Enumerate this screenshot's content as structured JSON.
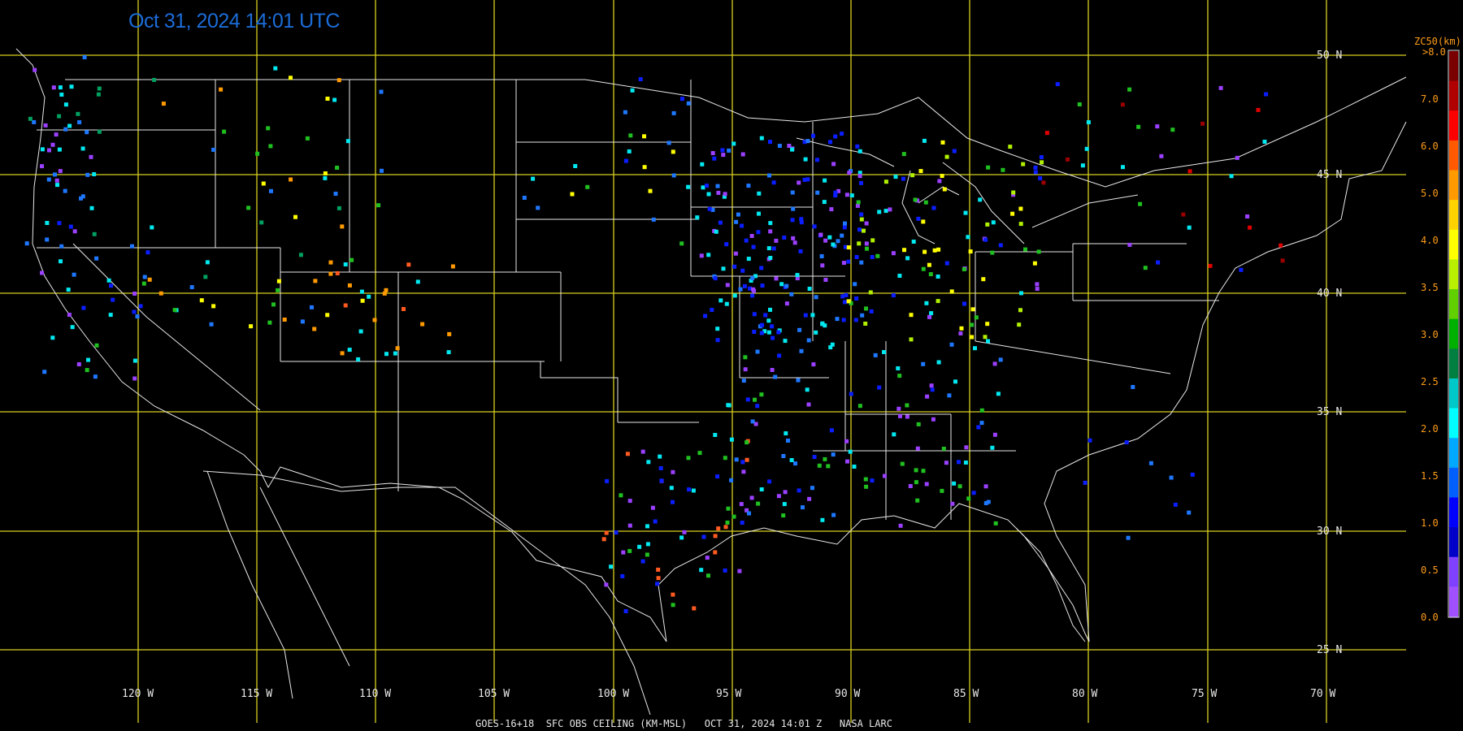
{
  "title": "Oct 31, 2024 14:01 UTC",
  "footer": "GOES-16+18  SFC OBS CEILING (KM-MSL)   OCT 31, 2024 14:01 Z   NASA LARC",
  "colorbar": {
    "title": "ZC50(km)",
    "top_label": ">8.0",
    "ticks": [
      "7.0",
      "6.0",
      "5.0",
      "4.0",
      "3.5",
      "3.0",
      "2.5",
      "2.0",
      "1.5",
      "1.0",
      "0.5",
      "0.0"
    ],
    "colors": [
      "#7a0000",
      "#b00000",
      "#ff0000",
      "#ff5a00",
      "#ff9b00",
      "#ffd200",
      "#ffff00",
      "#b8f000",
      "#60d000",
      "#00b000",
      "#008040",
      "#00c8c8",
      "#00ffff",
      "#00a8ff",
      "#0060ff",
      "#0000ff",
      "#0000c8",
      "#8040ff",
      "#a050ff"
    ]
  },
  "latitude_labels": [
    "50 N",
    "45 N",
    "40 N",
    "35 N",
    "30 N",
    "25 N"
  ],
  "longitude_labels": [
    "120 W",
    "115 W",
    "110 W",
    "105 W",
    "100 W",
    "95 W",
    "90 W",
    "85 W",
    "80 W",
    "75 W",
    "70 W"
  ],
  "station_colors": {
    "purple": "#9b40ff",
    "blue": "#0a1eff",
    "mid_blue": "#1e78ff",
    "cyan": "#00e8f0",
    "teal": "#00a060",
    "green": "#20c020",
    "yellow_green": "#b0f000",
    "yellow": "#ffff00",
    "orange": "#ff9a00",
    "red_orange": "#ff5a20",
    "red": "#e00000",
    "dark_red": "#9a0000"
  }
}
